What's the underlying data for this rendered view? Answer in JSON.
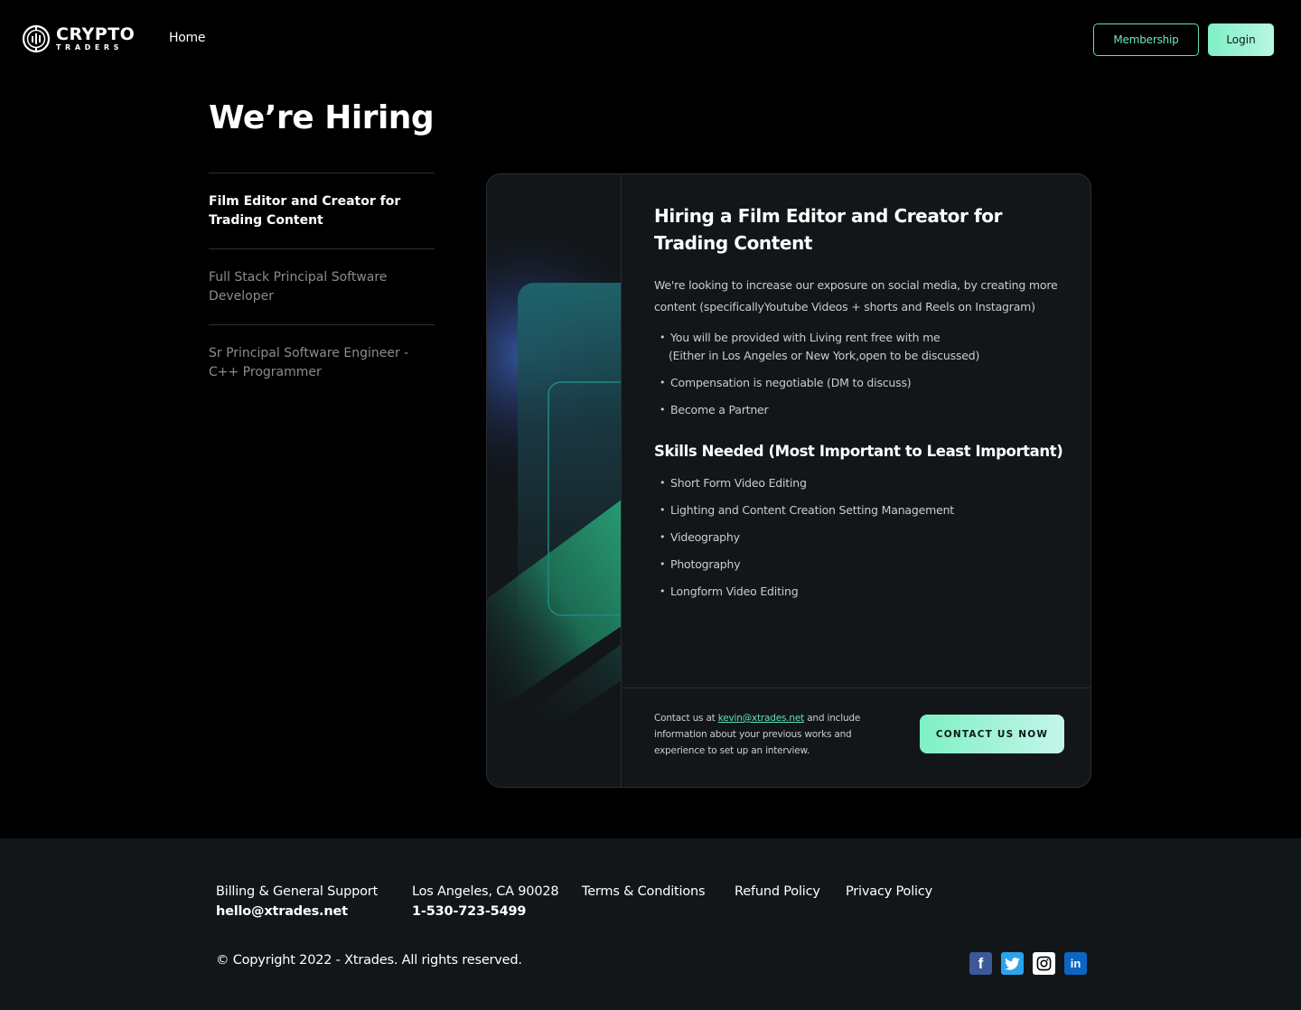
{
  "header": {
    "logo_word1": "CRYPTO",
    "logo_word2": "TRADERS",
    "nav_home": "Home",
    "membership_label": "Membership",
    "login_label": "Login"
  },
  "page": {
    "title": "We’re Hiring"
  },
  "jobs": [
    {
      "label": "Film Editor and Creator for Trading Content",
      "active": true
    },
    {
      "label": "Full Stack Principal Software Developer",
      "active": false
    },
    {
      "label": "Sr Principal Software Engineer - C++ Programmer",
      "active": false
    }
  ],
  "card": {
    "heading": "Hiring a Film Editor and Creator for Trading Content",
    "intro": "We're looking to increase our exposure on social media, by creating more content (specificallyYoutube Videos + shorts and Reels on Instagram)",
    "benefits": [
      {
        "main": "You will be provided with Living rent free with me",
        "sub": "(Either in Los Angeles or New York,open to be discussed)"
      },
      {
        "main": "Compensation is negotiable (DM to discuss)"
      },
      {
        "main": "Become a Partner"
      }
    ],
    "skills_heading": "Skills Needed (Most Important to Least Important)",
    "skills": [
      "Short Form Video Editing",
      "Lighting and Content Creation Setting Management",
      "Videography",
      "Photography",
      "Longform Video Editing"
    ],
    "contact_prefix": "Contact us at",
    "contact_email": "kevin@xtrades.net",
    "contact_suffix": "and include information about your previous works and experience to set up an interview.",
    "contact_button": "CONTACT US NOW"
  },
  "footer": {
    "support_label": "Billing & General Support",
    "support_email": "hello@xtrades.net",
    "address": "Los Angeles, CA 90028",
    "phone": "1-530-723-5499",
    "terms": "Terms & Conditions",
    "refund": "Refund Policy",
    "privacy": "Privacy Policy",
    "copyright": "© Copyright 2022 - Xtrades. All rights reserved.",
    "socials": [
      "facebook-icon",
      "twitter-icon",
      "instagram-icon",
      "linkedin-icon"
    ]
  },
  "colors": {
    "accent": "#6ee7b7",
    "background": "#000000",
    "card": "#121619",
    "footer": "#121619"
  }
}
